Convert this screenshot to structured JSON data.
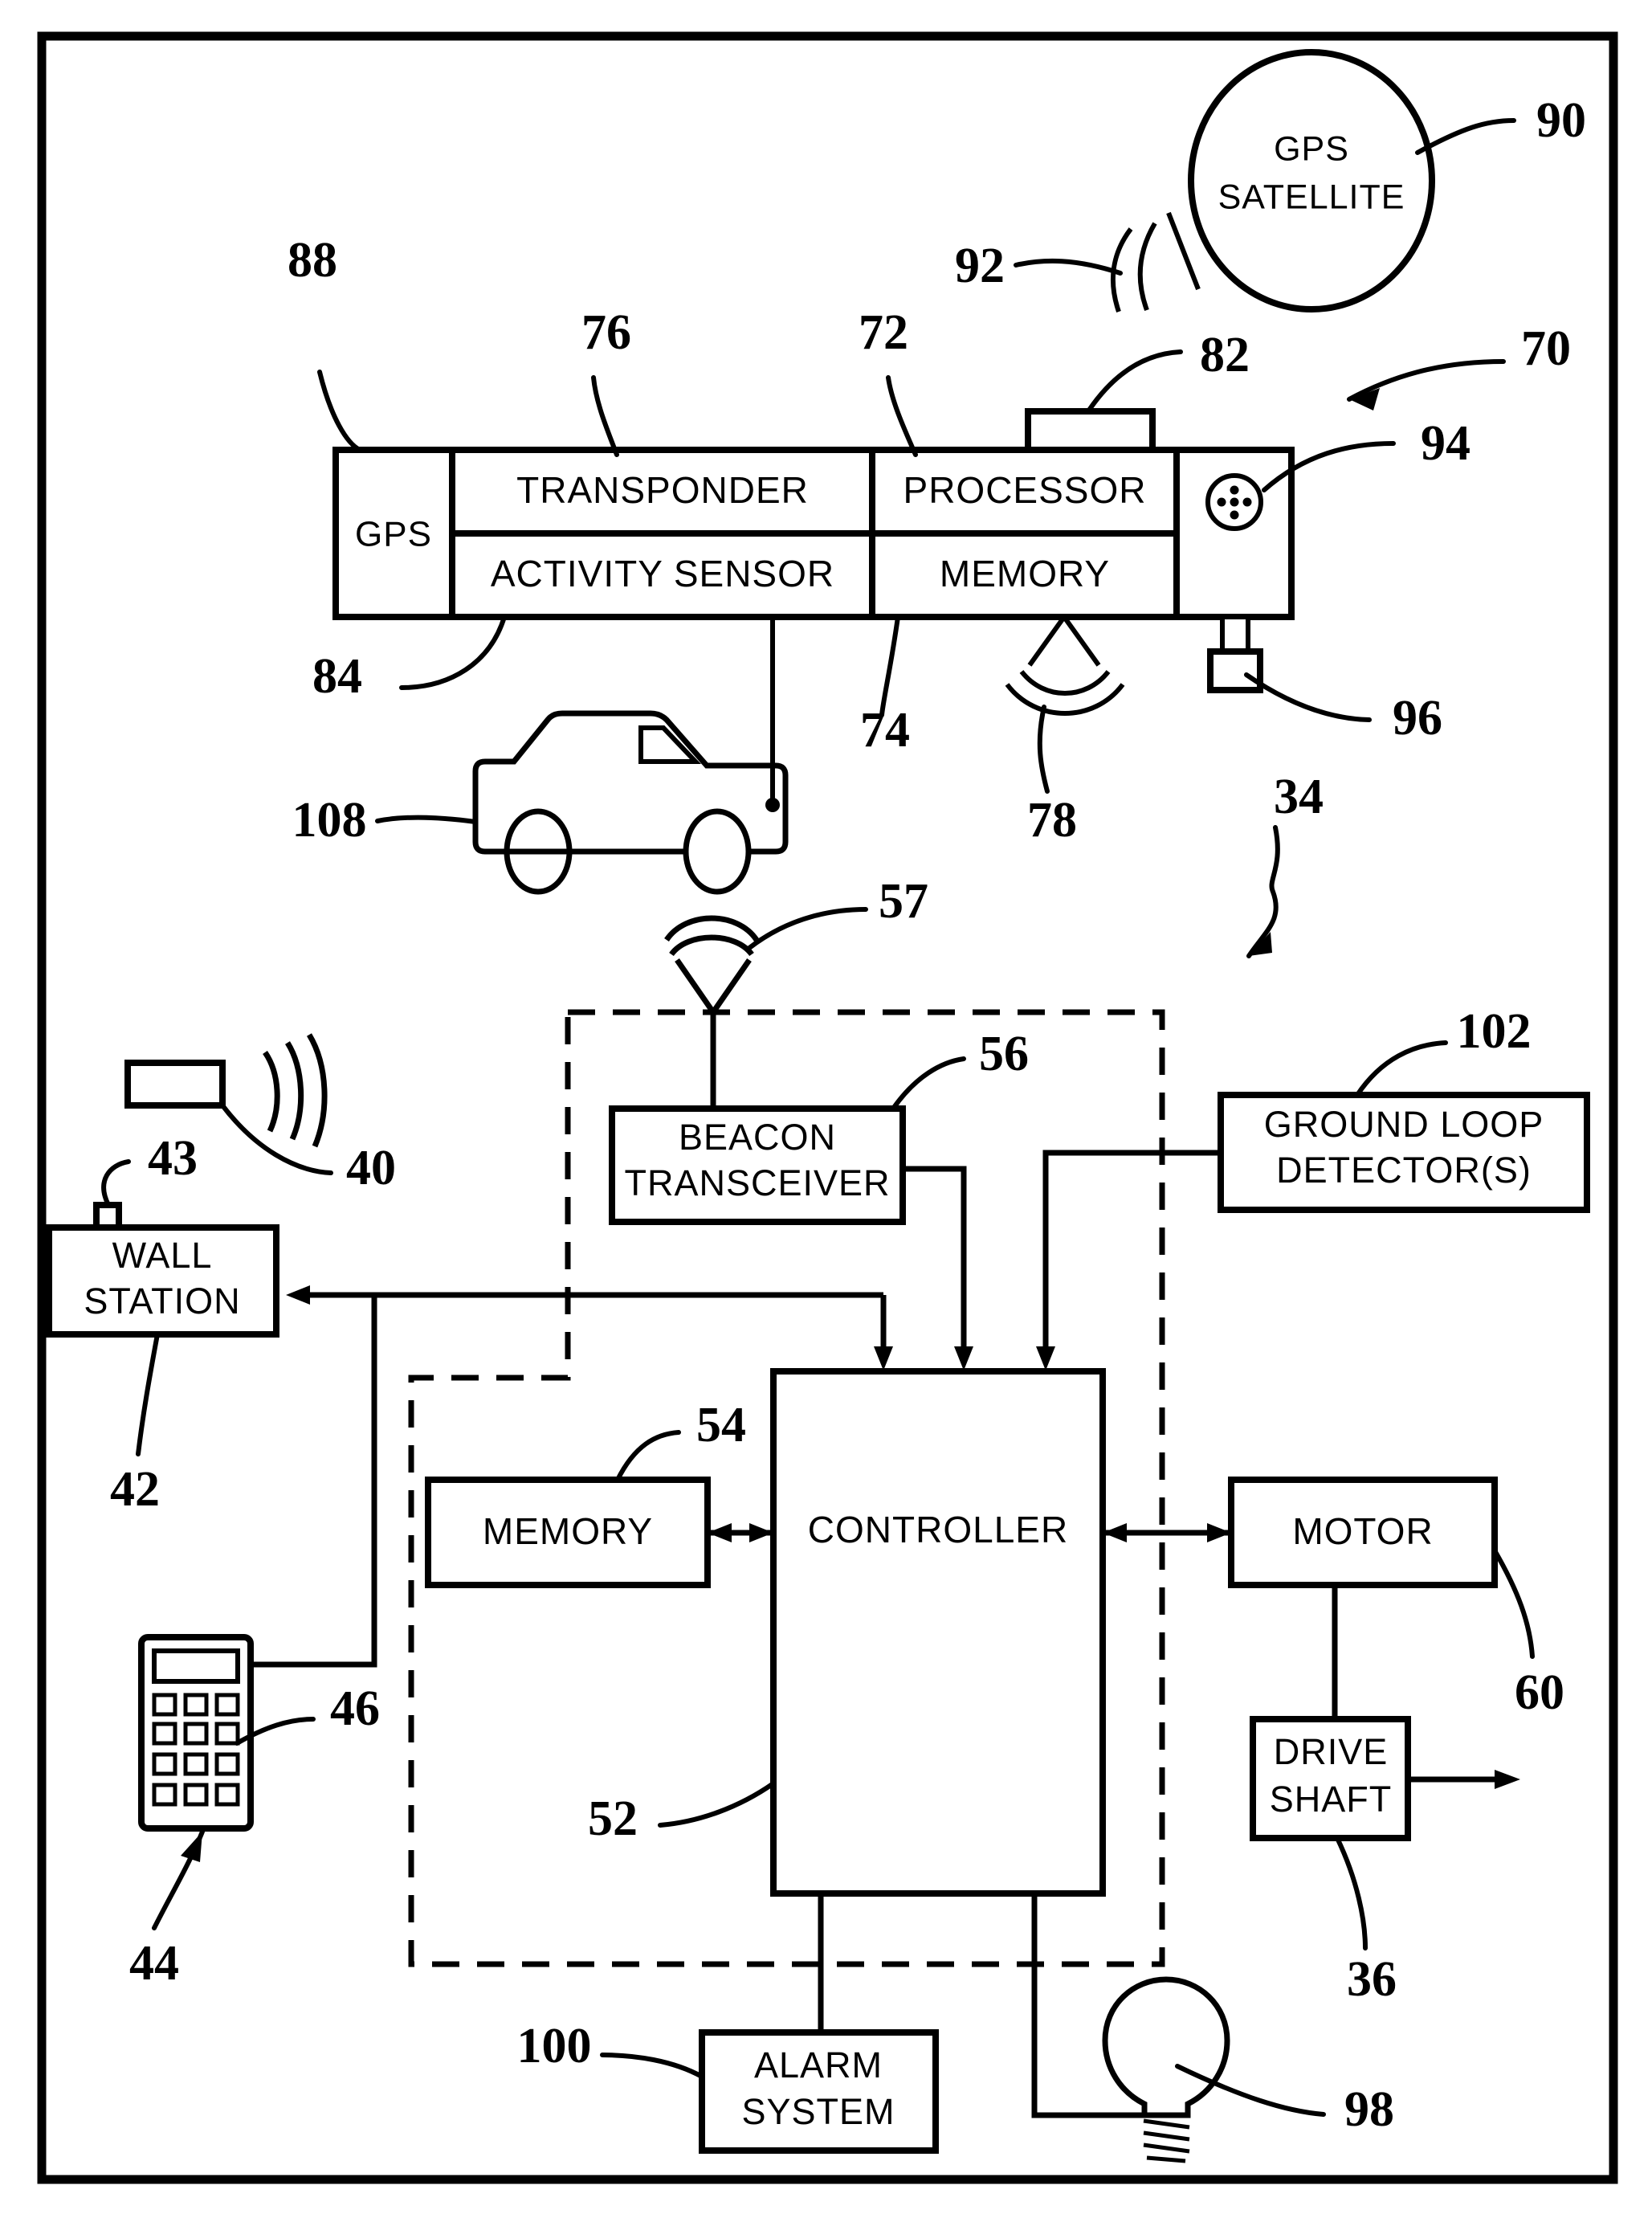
{
  "figure": {
    "type": "patent-block-diagram",
    "border": true
  },
  "blocks": {
    "gps": "GPS",
    "transponder": "TRANSPONDER",
    "processor": "PROCESSOR",
    "activity_sensor": "ACTIVITY  SENSOR",
    "memory_top": "MEMORY",
    "gps_satellite_line1": "GPS",
    "gps_satellite_line2": "SATELLITE",
    "beacon_line1": "BEACON",
    "beacon_line2": "TRANSCEIVER",
    "ground_loop_line1": "GROUND  LOOP",
    "ground_loop_line2": "DETECTOR(S)",
    "wall_station_line1": "WALL",
    "wall_station_line2": "STATION",
    "memory_bottom": "MEMORY",
    "controller": "CONTROLLER",
    "motor": "MOTOR",
    "drive_shaft_line1": "DRIVE",
    "drive_shaft_line2": "SHAFT",
    "alarm_line1": "ALARM",
    "alarm_line2": "SYSTEM"
  },
  "reference_numerals": {
    "n88": "88",
    "n76": "76",
    "n72": "72",
    "n82": "82",
    "n70": "70",
    "n90": "90",
    "n92": "92",
    "n94": "94",
    "n96": "96",
    "n84": "84",
    "n74": "74",
    "n78": "78",
    "n108": "108",
    "n34": "34",
    "n57": "57",
    "n56": "56",
    "n102": "102",
    "n40": "40",
    "n43": "43",
    "n42": "42",
    "n46": "46",
    "n44": "44",
    "n54": "54",
    "n52": "52",
    "n60": "60",
    "n36": "36",
    "n100": "100",
    "n98": "98"
  },
  "icons": {
    "vehicle": "pickup-truck-icon",
    "satellite": "gps-satellite-ellipse-icon",
    "speaker": "speaker-grille-icon",
    "antenna": "beacon-antenna-icon",
    "remote": "remote-transmitter-icon",
    "keypad": "keypad-icon",
    "lightbulb": "light-bulb-icon",
    "rf_waves": "radio-wave-arcs-icon",
    "ir_waves": "infrared-wave-arcs-icon"
  },
  "colors": {
    "ink": "#000000",
    "paper": "#ffffff"
  }
}
